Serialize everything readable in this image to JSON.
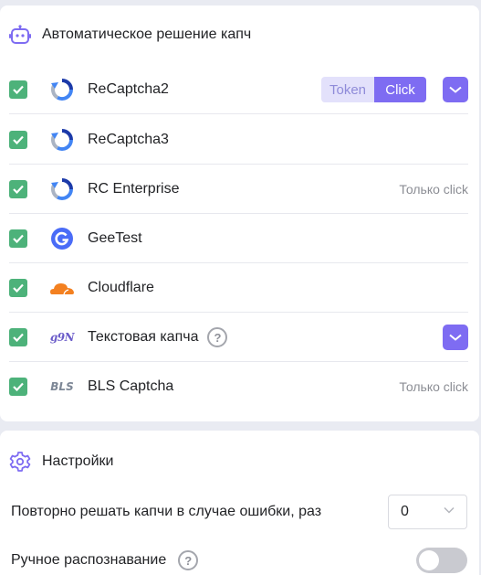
{
  "auto_section": {
    "title": "Автоматическое решение капч",
    "icon": "robot-icon"
  },
  "captchas": [
    {
      "name": "ReCaptcha2",
      "logo": "recaptcha-icon",
      "checked": true,
      "mode_options": [
        "Token",
        "Click"
      ],
      "selected_mode": "Click",
      "has_expand": true
    },
    {
      "name": "ReCaptcha3",
      "logo": "recaptcha-icon",
      "checked": true
    },
    {
      "name": "RC Enterprise",
      "logo": "recaptcha-icon",
      "checked": true,
      "note": "Только click"
    },
    {
      "name": "GeeTest",
      "logo": "geetest-icon",
      "checked": true
    },
    {
      "name": "Cloudflare",
      "logo": "cloudflare-icon",
      "checked": true
    },
    {
      "name": "Текстовая капча",
      "logo": "text-captcha-icon",
      "logo_text": "g9N",
      "checked": true,
      "help": "?",
      "has_expand": true
    },
    {
      "name": "BLS Captcha",
      "logo": "bls-icon",
      "logo_text": "BLS",
      "checked": true,
      "note": "Только click"
    }
  ],
  "settings_section": {
    "title": "Настройки",
    "icon": "gear-icon",
    "retry_label": "Повторно решать капчи в случае ошибки, раз",
    "retry_value": "0",
    "manual_label": "Ручное распознавание",
    "manual_help": "?",
    "manual_enabled": false
  },
  "colors": {
    "accent": "#7e6cf2",
    "checkbox": "#4db27a",
    "background": "#e9ebf2"
  }
}
